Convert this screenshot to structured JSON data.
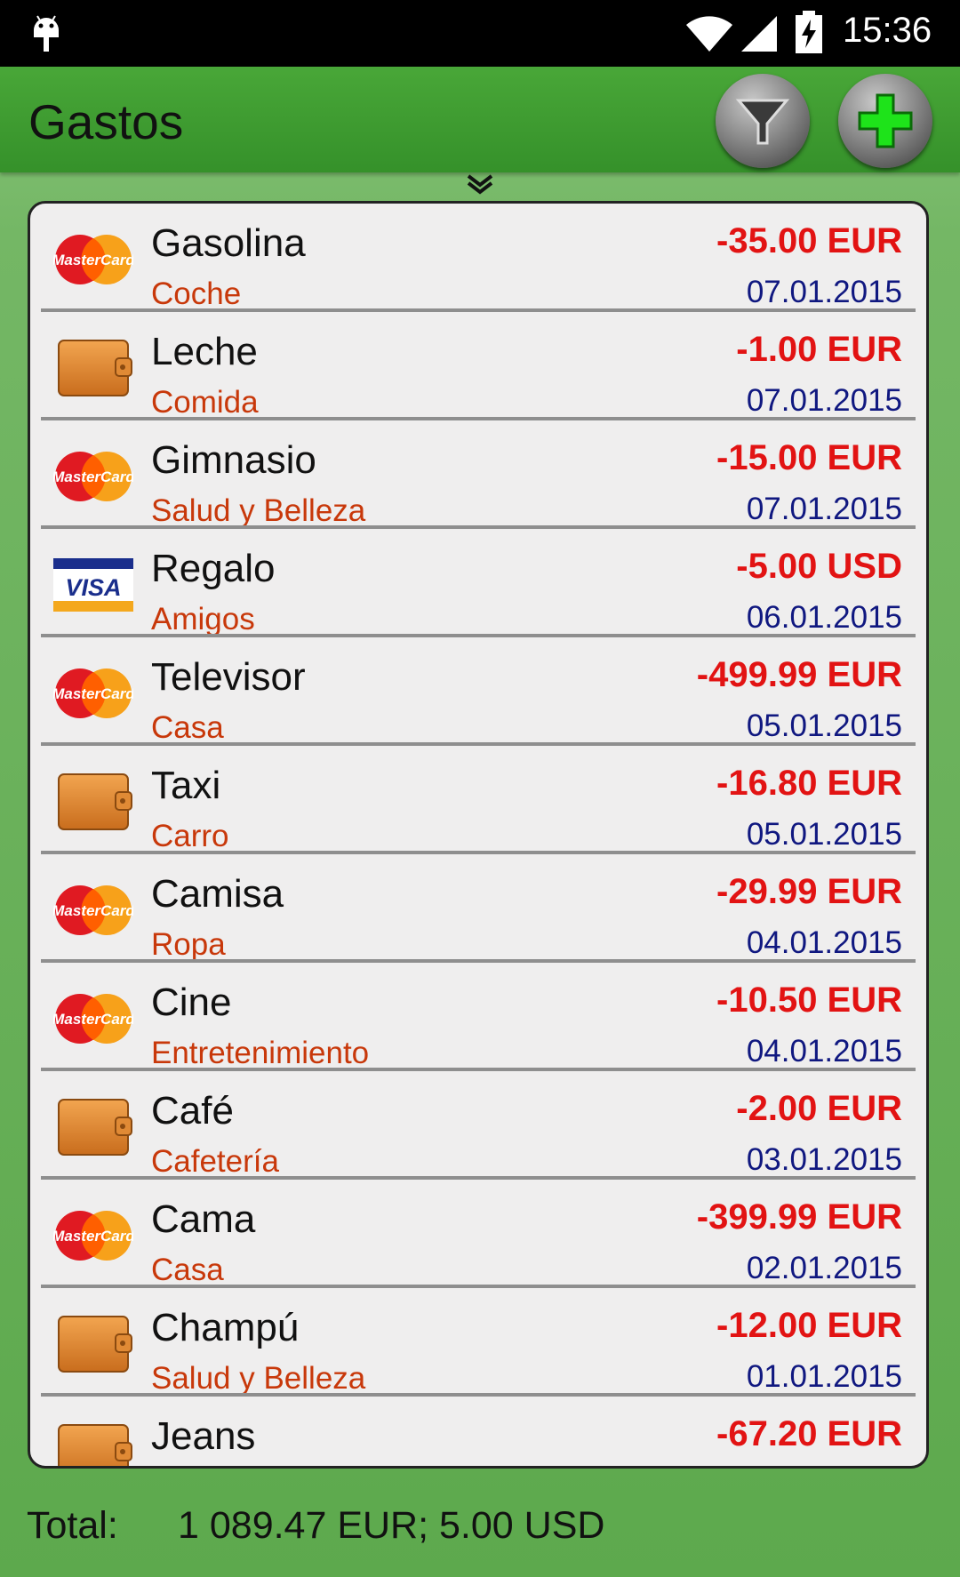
{
  "status_bar": {
    "time": "15:36"
  },
  "app_bar": {
    "title": "Gastos"
  },
  "expenses": [
    {
      "name": "Gasolina",
      "category": "Coche",
      "amount": "-35.00 EUR",
      "date": "07.01.2015",
      "payment": "mastercard-icon"
    },
    {
      "name": "Leche",
      "category": "Comida",
      "amount": "-1.00 EUR",
      "date": "07.01.2015",
      "payment": "wallet-icon"
    },
    {
      "name": "Gimnasio",
      "category": "Salud y Belleza",
      "amount": "-15.00 EUR",
      "date": "07.01.2015",
      "payment": "mastercard-icon"
    },
    {
      "name": "Regalo",
      "category": "Amigos",
      "amount": "-5.00 USD",
      "date": "06.01.2015",
      "payment": "visa-icon"
    },
    {
      "name": "Televisor",
      "category": "Casa",
      "amount": "-499.99 EUR",
      "date": "05.01.2015",
      "payment": "mastercard-icon"
    },
    {
      "name": "Taxi",
      "category": "Carro",
      "amount": "-16.80 EUR",
      "date": "05.01.2015",
      "payment": "wallet-icon"
    },
    {
      "name": "Camisa",
      "category": "Ropa",
      "amount": "-29.99 EUR",
      "date": "04.01.2015",
      "payment": "mastercard-icon"
    },
    {
      "name": "Cine",
      "category": "Entretenimiento",
      "amount": "-10.50 EUR",
      "date": "04.01.2015",
      "payment": "mastercard-icon"
    },
    {
      "name": "Café",
      "category": "Cafetería",
      "amount": "-2.00 EUR",
      "date": "03.01.2015",
      "payment": "wallet-icon"
    },
    {
      "name": "Cama",
      "category": "Casa",
      "amount": "-399.99 EUR",
      "date": "02.01.2015",
      "payment": "mastercard-icon"
    },
    {
      "name": "Champú",
      "category": "Salud y Belleza",
      "amount": "-12.00 EUR",
      "date": "01.01.2015",
      "payment": "wallet-icon"
    },
    {
      "name": "Jeans",
      "category": "",
      "amount": "-67.20 EUR",
      "date": "",
      "payment": "wallet-icon"
    }
  ],
  "card_logos": {
    "mastercard": "MasterCard",
    "visa": "VISA"
  },
  "footer": {
    "total_label": "Total:",
    "total_value": "1 089.47 EUR; 5.00 USD"
  },
  "colors": {
    "amount": "#e21313",
    "category": "#c8380a",
    "date": "#101880",
    "appbar": "#3f9d31"
  }
}
